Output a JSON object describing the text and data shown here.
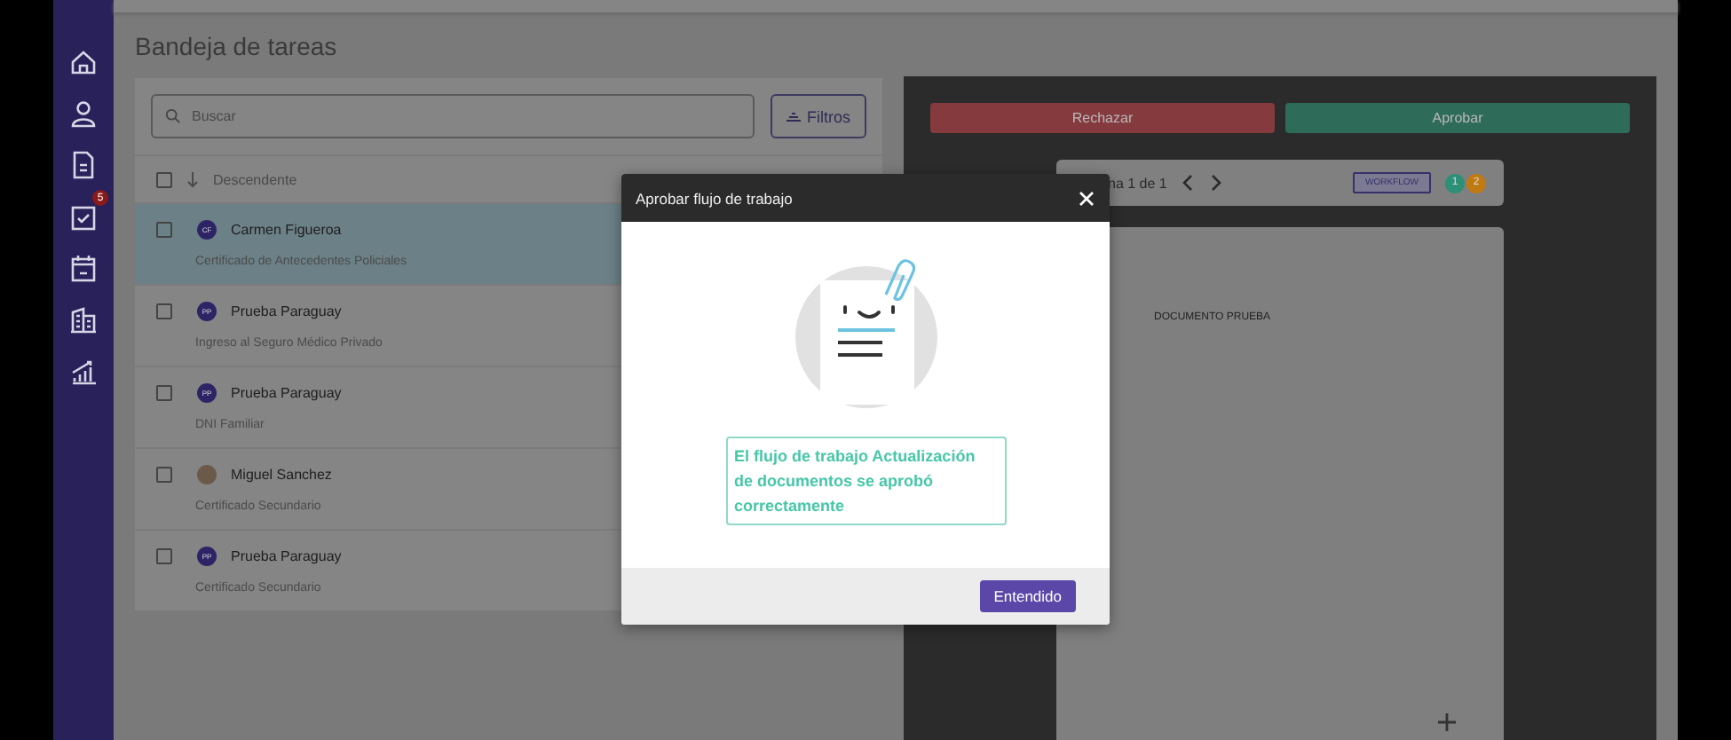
{
  "sidebar": {
    "items": [
      {
        "kind": "home"
      },
      {
        "kind": "user"
      },
      {
        "kind": "document"
      },
      {
        "kind": "tasks",
        "badge": "5"
      },
      {
        "kind": "calendar"
      },
      {
        "kind": "building"
      },
      {
        "kind": "chart"
      }
    ]
  },
  "page_title": "Bandeja de tareas",
  "search": {
    "placeholder": "Buscar"
  },
  "filters_button": "Filtros",
  "sort_label": "Descendente",
  "select_all_checked": false,
  "tasks": [
    {
      "kind": "initials",
      "initials": "CF",
      "name": "Carmen Figueroa",
      "document": "Certificado de Antecedentes Policiales",
      "selected": true,
      "checked": false
    },
    {
      "kind": "initials",
      "initials": "PP",
      "name": "Prueba Paraguay",
      "document": "Ingreso al Seguro Médico Privado",
      "selected": false,
      "checked": false
    },
    {
      "kind": "initials",
      "initials": "PP",
      "name": "Prueba Paraguay",
      "document": "DNI Familiar",
      "selected": false,
      "checked": false
    },
    {
      "kind": "photo",
      "name": "Miguel Sanchez",
      "document": "Certificado Secundario",
      "selected": false,
      "checked": false
    },
    {
      "kind": "initials",
      "initials": "PP",
      "name": "Prueba Paraguay",
      "document": "Certificado Secundario",
      "selected": false,
      "checked": false
    }
  ],
  "viewer": {
    "reject_button": "Rechazar",
    "approve_button": "Aprobar",
    "page_indicator": "na 1 de 1",
    "workflow_tag": "WORKFLOW",
    "steps": [
      {
        "label": "1",
        "color": "#2e8f77"
      },
      {
        "label": "2",
        "color": "#c07a12"
      }
    ],
    "document_text": "DOCUMENTO PRUEBA"
  },
  "dialog": {
    "title": "Aprobar flujo de trabajo",
    "message": "El flujo de trabajo Actualización de documentos se aprobó correctamente",
    "confirm_button": "Entendido"
  }
}
